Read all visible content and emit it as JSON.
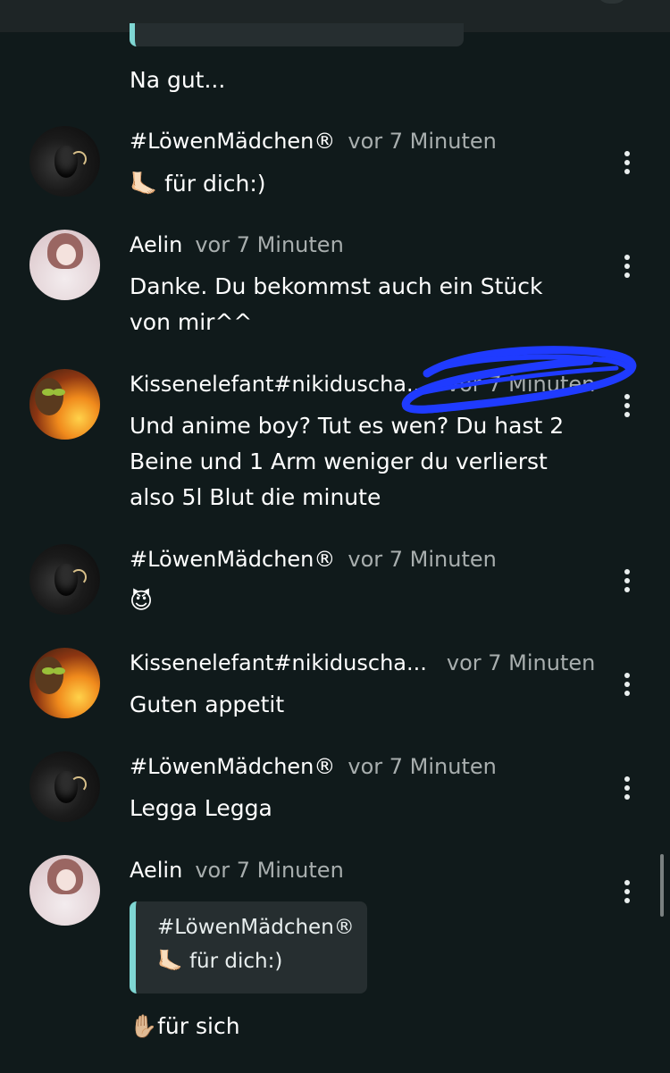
{
  "previous_message": {
    "text": "Na gut..."
  },
  "messages": [
    {
      "name": "#LöwenMädchen®",
      "time": "vor 7 Minuten",
      "text": "🦶🏻 für dich:)",
      "avatar": "lion-avatar"
    },
    {
      "name": "Aelin",
      "time": "vor 7 Minuten",
      "text": "Danke. Du bekommst auch ein Stück von mir^^",
      "avatar": "girl-avatar"
    },
    {
      "name": "Kissenelefant#nikiduscha...",
      "time": "vor 7 Minuten",
      "text": "Und anime boy? Tut es wen? Du hast 2 Beine und 1 Arm weniger du verlierst also 5l Blut die minute",
      "avatar": "fire-avatar"
    },
    {
      "name": "#LöwenMädchen®",
      "time": "vor 7 Minuten",
      "text": "😈",
      "avatar": "lion-avatar"
    },
    {
      "name": "Kissenelefant#nikiduscha...",
      "time": "vor 7 Minuten",
      "text": "Guten appetit",
      "avatar": "fire-avatar"
    },
    {
      "name": "#LöwenMädchen®",
      "time": "vor 7 Minuten",
      "text": "Legga Legga",
      "avatar": "lion-avatar"
    },
    {
      "name": "Aelin",
      "time": "vor 7 Minuten",
      "quote": {
        "name": "#LöwenMädchen®",
        "text": "🦶🏻 für dich:)"
      },
      "text": "✋🏼für sich",
      "avatar": "girl-avatar"
    }
  ],
  "colors": {
    "background": "#101a1b",
    "quote_accent": "#7fd6d3",
    "timestamp": "#a8aeae",
    "highlight_scribble": "#1f3bff"
  },
  "icons": {
    "more_options": "kebab-menu-icon"
  }
}
